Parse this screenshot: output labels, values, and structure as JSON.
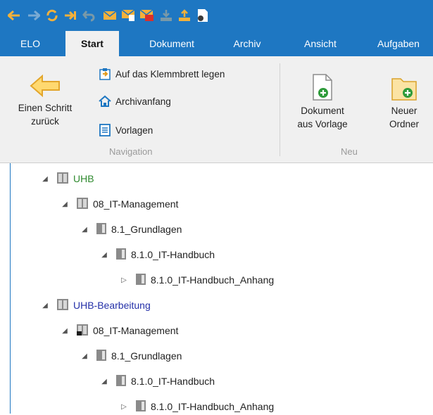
{
  "tabs": [
    "ELO",
    "Start",
    "Dokument",
    "Archiv",
    "Ansicht",
    "Aufgaben"
  ],
  "active_tab": "Start",
  "ribbon": {
    "back_button": {
      "line1": "Einen Schritt",
      "line2": "zurück"
    },
    "clipboard_label": "Auf das Klemmbrett legen",
    "archive_home_label": "Archivanfang",
    "templates_label": "Vorlagen",
    "nav_group_label": "Navigation",
    "doc_from_template": {
      "line1": "Dokument",
      "line2": "aus Vorlage"
    },
    "new_folder": {
      "line1": "Neuer",
      "line2": "Ordner"
    },
    "new_group_label": "Neu"
  },
  "quick_access_icons": [
    "back-arrow-icon",
    "forward-arrow-icon",
    "refresh-icon",
    "goto-icon",
    "undo-icon",
    "email-icon",
    "email-document-icon",
    "email-pdf-icon",
    "import-icon",
    "export-icon",
    "scan-document-icon"
  ],
  "tree": [
    {
      "label": "UHB",
      "level": 0,
      "toggle": "expanded",
      "type": "cabinet",
      "color": "green"
    },
    {
      "label": "08_IT-Management",
      "level": 1,
      "toggle": "expanded",
      "type": "cabinet",
      "color": "default"
    },
    {
      "label": "8.1_Grundlagen",
      "level": 2,
      "toggle": "expanded",
      "type": "folder",
      "color": "default"
    },
    {
      "label": "8.1.0_IT-Handbuch",
      "level": 3,
      "toggle": "expanded",
      "type": "folder",
      "color": "default"
    },
    {
      "label": "8.1.0_IT-Handbuch_Anhang",
      "level": 4,
      "toggle": "collapsed",
      "type": "folder",
      "color": "default"
    },
    {
      "label": "UHB-Bearbeitung",
      "level": 0,
      "toggle": "expanded",
      "type": "cabinet",
      "color": "blue"
    },
    {
      "label": "08_IT-Management",
      "level": 1,
      "toggle": "expanded",
      "type": "cabinet-edit",
      "color": "default"
    },
    {
      "label": "8.1_Grundlagen",
      "level": 2,
      "toggle": "expanded",
      "type": "folder",
      "color": "default"
    },
    {
      "label": "8.1.0_IT-Handbuch",
      "level": 3,
      "toggle": "expanded",
      "type": "folder",
      "color": "default"
    },
    {
      "label": "8.1.0_IT-Handbuch_Anhang",
      "level": 4,
      "toggle": "collapsed",
      "type": "folder",
      "color": "default"
    }
  ],
  "colors": {
    "accent": "#1e77c2",
    "green_label": "#2f8a2f",
    "blue_label": "#2430a8",
    "icon_orange": "#f3b13b"
  }
}
